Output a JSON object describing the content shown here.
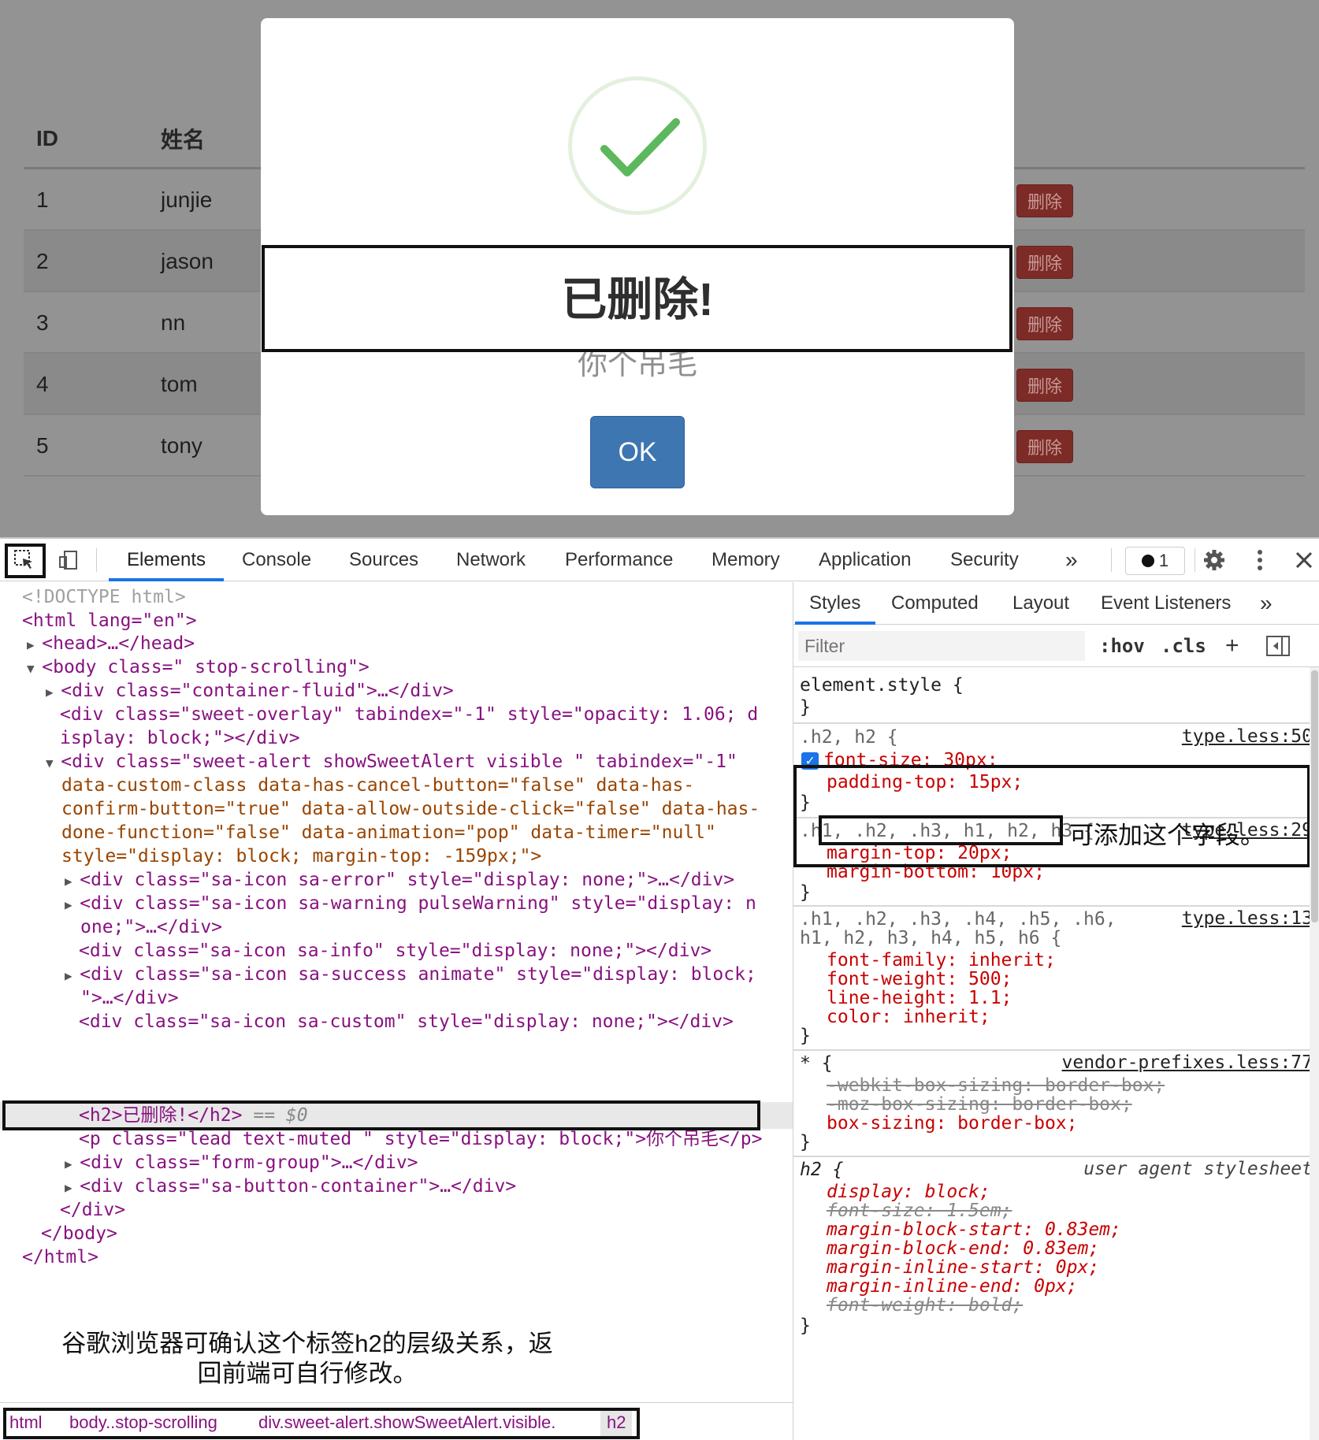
{
  "table": {
    "headers": [
      "ID",
      "姓名"
    ],
    "rows": [
      {
        "id": "1",
        "name": "junjie"
      },
      {
        "id": "2",
        "name": "jason"
      },
      {
        "id": "3",
        "name": "nn"
      },
      {
        "id": "4",
        "name": "tom"
      },
      {
        "id": "5",
        "name": "tony"
      }
    ],
    "delete_label": "删除"
  },
  "alert": {
    "title": "已删除!",
    "text": "你个吊毛",
    "ok_label": "OK"
  },
  "devtools": {
    "tabs": [
      "Elements",
      "Console",
      "Sources",
      "Network",
      "Performance",
      "Memory",
      "Application",
      "Security"
    ],
    "more": "»",
    "issues_count": "1",
    "elements": {
      "lines": [
        "<!DOCTYPE html>",
        "<html lang=\"en\">",
        "<head>…</head>",
        "<body class=\" stop-scrolling\">",
        "<div class=\"container-fluid\">…</div>",
        "<div class=\"sweet-overlay\" tabindex=\"-1\" style=\"opacity: 1.06; d",
        "isplay: block;\"></div>",
        "<div class=\"sweet-alert showSweetAlert visible \" tabindex=\"-1\"",
        "data-custom-class data-has-cancel-button=\"false\" data-has-",
        "confirm-button=\"true\" data-allow-outside-click=\"false\" data-has-",
        "done-function=\"false\" data-animation=\"pop\" data-timer=\"null\"",
        "style=\"display: block; margin-top: -159px;\">",
        "<div class=\"sa-icon sa-error\" style=\"display: none;\">…</div>",
        "<div class=\"sa-icon sa-warning pulseWarning\" style=\"display: n",
        "one;\">…</div>",
        "<div class=\"sa-icon sa-info\" style=\"display: none;\"></div>",
        "<div class=\"sa-icon sa-success animate\" style=\"display: block;",
        "\">…</div>",
        "<div class=\"sa-icon sa-custom\" style=\"display: none;\"></div>",
        "<h2>已删除!</h2>",
        "<p class=\"lead text-muted \" style=\"display: block;\">你个吊毛</p>",
        "<div class=\"form-group\">…</div>",
        "<div class=\"sa-button-container\">…</div>",
        "</div>",
        "</body>",
        "</html>"
      ],
      "selected_suffix": "== $0",
      "note": "谷歌浏览器可确认这个标签h2的层级关系，返回前端可自行修改。",
      "breadcrumbs": [
        "html",
        "body..stop-scrolling",
        "div.sweet-alert.showSweetAlert.visible.",
        "h2"
      ]
    },
    "styles": {
      "tabs": [
        "Styles",
        "Computed",
        "Layout",
        "Event Listeners"
      ],
      "filter_placeholder": "Filter",
      "hov": ":hov",
      "cls": ".cls",
      "note": "可添加这个字段。",
      "rules": {
        "element": "element.style {",
        "r1_sel": ".h2, h2 {",
        "r1_src": "type.less:50",
        "r1_p1": "font-size: 30px;",
        "r1_p2": "padding-top: 15px;",
        "r2_sel": ".h1, .h2, .h3, h1, h2, h3 {",
        "r2_src": "type.less:29",
        "r2_p1": "margin-top: 20px;",
        "r2_p2": "margin-bottom: 10px;",
        "r3_sel1": ".h1, .h2, .h3, .h4, .h5, .h6,",
        "r3_sel2": "h1, h2, h3, h4, h5, h6 {",
        "r3_src": "type.less:13",
        "r3_p1": "font-family: inherit;",
        "r3_p2": "font-weight: 500;",
        "r3_p3": "line-height: 1.1;",
        "r3_p4": "color: inherit;",
        "r4_sel": "* {",
        "r4_src": "vendor-prefixes.less:77",
        "r4_p1": "-webkit-box-sizing: border-box;",
        "r4_p2": "-moz-box-sizing: border-box;",
        "r4_p3": "box-sizing: border-box;",
        "r5_sel": "h2 {",
        "r5_src": "user agent stylesheet",
        "r5_p1": "display: block;",
        "r5_p2": "font-size: 1.5em;",
        "r5_p3": "margin-block-start: 0.83em;",
        "r5_p4": "margin-block-end: 0.83em;",
        "r5_p5": "margin-inline-start: 0px;",
        "r5_p6": "margin-inline-end: 0px;",
        "r5_p7": "font-weight: bold;",
        "close": "}"
      }
    }
  },
  "colors": {
    "overlay": "#939393",
    "success_check": "#5cb85c",
    "ok_button": "#3d76b1",
    "delete_button": "#7c2b27",
    "devtools_accent": "#1a73e8",
    "tag": "#881280",
    "attr": "#994500",
    "value": "#1a1aa6",
    "css_prop": "#c80000"
  }
}
